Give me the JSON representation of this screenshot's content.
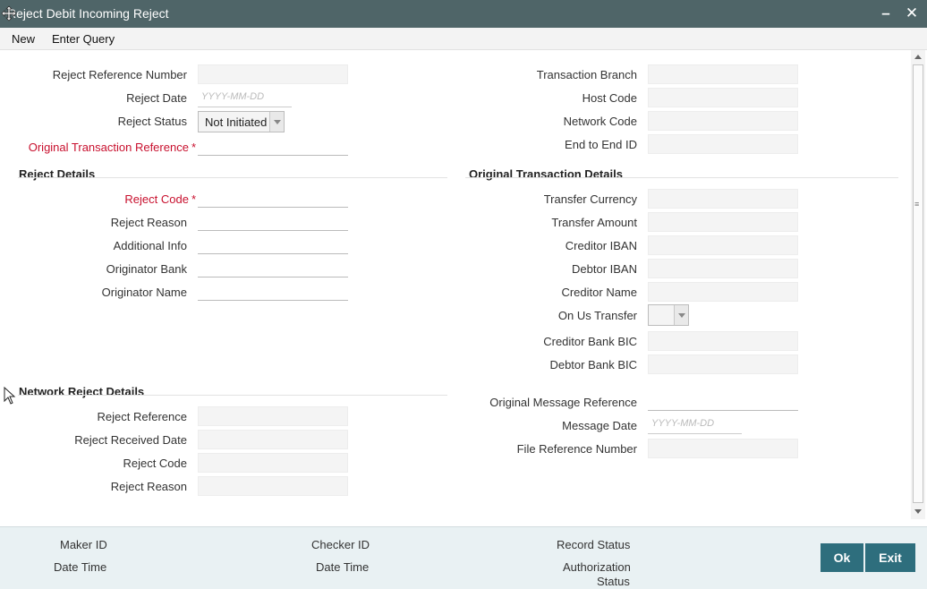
{
  "window": {
    "title": "Reject Debit Incoming Reject"
  },
  "menu": {
    "new": "New",
    "enter_query": "Enter Query"
  },
  "header_left": {
    "reject_reference_number": "Reject Reference Number",
    "reject_date": "Reject Date",
    "reject_date_placeholder": "YYYY-MM-DD",
    "reject_status": "Reject Status",
    "reject_status_value": "Not Initiated",
    "original_transaction_reference": "Original Transaction Reference",
    "required_mark": "*"
  },
  "header_right": {
    "transaction_branch": "Transaction Branch",
    "host_code": "Host Code",
    "network_code": "Network Code",
    "end_to_end_id": "End to End ID"
  },
  "reject_details": {
    "title": "Reject Details",
    "reject_code": "Reject Code",
    "reject_reason": "Reject Reason",
    "additional_info": "Additional Info",
    "originator_bank": "Originator Bank",
    "originator_name": "Originator Name"
  },
  "original_transaction_details": {
    "title": "Original Transaction Details",
    "transfer_currency": "Transfer Currency",
    "transfer_amount": "Transfer Amount",
    "creditor_iban": "Creditor IBAN",
    "debtor_iban": "Debtor IBAN",
    "creditor_name": "Creditor Name",
    "on_us_transfer": "On Us Transfer",
    "creditor_bank_bic": "Creditor Bank BIC",
    "debtor_bank_bic": "Debtor Bank BIC"
  },
  "network_reject_details": {
    "title": "Network Reject Details",
    "reject_reference": "Reject Reference",
    "reject_received_date": "Reject Received Date",
    "reject_code": "Reject Code",
    "reject_reason": "Reject Reason"
  },
  "message_details": {
    "original_message_reference": "Original Message Reference",
    "message_date": "Message Date",
    "message_date_placeholder": "YYYY-MM-DD",
    "file_reference_number": "File Reference Number"
  },
  "footer": {
    "maker_id": "Maker ID",
    "date_time_1": "Date Time",
    "checker_id": "Checker ID",
    "date_time_2": "Date Time",
    "record_status": "Record Status",
    "authorization_status_1": "Authorization",
    "authorization_status_2": "Status",
    "ok": "Ok",
    "exit": "Exit"
  },
  "titlebar_buttons": {
    "minimize": "–",
    "close": "✕"
  }
}
